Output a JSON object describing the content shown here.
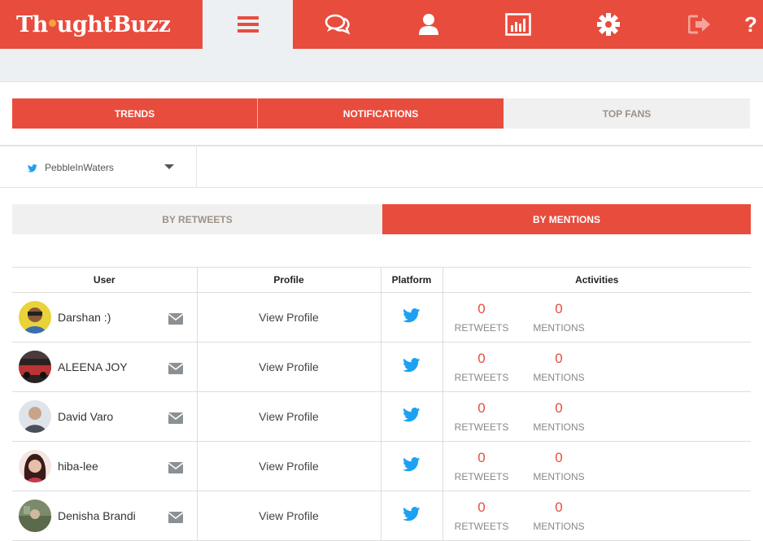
{
  "app": {
    "logo_pre": "Th",
    "logo_post": "ughtBuzz",
    "accent": "#e84c3d"
  },
  "nav": {
    "icons": [
      "menu-icon",
      "chat-icon",
      "user-icon",
      "report-icon",
      "gear-icon",
      "logout-icon",
      "help-icon"
    ],
    "help_label": "?"
  },
  "tabs": {
    "trends": "TRENDS",
    "notifications": "NOTIFICATIONS",
    "top_fans": "TOP FANS"
  },
  "account": {
    "name": "PebbleInWaters",
    "platform_icon": "twitter-icon"
  },
  "subtabs": {
    "by_retweets": "BY RETWEETS",
    "by_mentions": "BY MENTIONS"
  },
  "table": {
    "headers": {
      "user": "User",
      "profile": "Profile",
      "platform": "Platform",
      "activities": "Activities"
    },
    "retweets_label": "RETWEETS",
    "mentions_label": "MENTIONS",
    "rows": [
      {
        "name": "Darshan :)",
        "profile": "View Profile",
        "retweets": "0",
        "mentions": "0"
      },
      {
        "name": "ALEENA JOY",
        "profile": "View Profile",
        "retweets": "0",
        "mentions": "0"
      },
      {
        "name": "David Varo",
        "profile": "View Profile",
        "retweets": "0",
        "mentions": "0"
      },
      {
        "name": "hiba-lee",
        "profile": "View Profile",
        "retweets": "0",
        "mentions": "0"
      },
      {
        "name": "Denisha Brandi",
        "profile": "View Profile",
        "retweets": "0",
        "mentions": "0"
      }
    ]
  }
}
